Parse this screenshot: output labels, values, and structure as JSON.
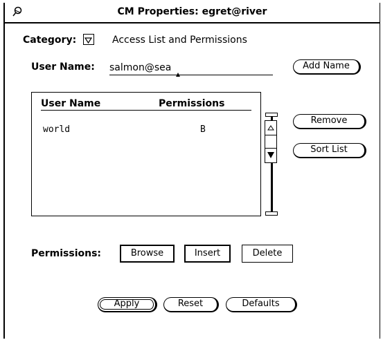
{
  "window": {
    "title": "CM Properties: egret@river",
    "pin_icon": "pushpin-icon"
  },
  "category": {
    "label": "Category:",
    "selected": "Access List and Permissions",
    "menu_icon": "menu-triangle-icon"
  },
  "user_name": {
    "label": "User Name:",
    "value": "salmon@sea"
  },
  "buttons": {
    "add_name": "Add Name",
    "remove": "Remove",
    "sort_list": "Sort List",
    "apply": "Apply",
    "reset": "Reset",
    "defaults": "Defaults"
  },
  "access_list": {
    "columns": [
      "User Name",
      "Permissions"
    ],
    "rows": [
      {
        "user": "world",
        "permissions": "B"
      }
    ]
  },
  "permissions": {
    "label": "Permissions:",
    "options": [
      {
        "label": "Browse",
        "selected": true
      },
      {
        "label": "Insert",
        "selected": true
      },
      {
        "label": "Delete",
        "selected": false
      }
    ]
  }
}
